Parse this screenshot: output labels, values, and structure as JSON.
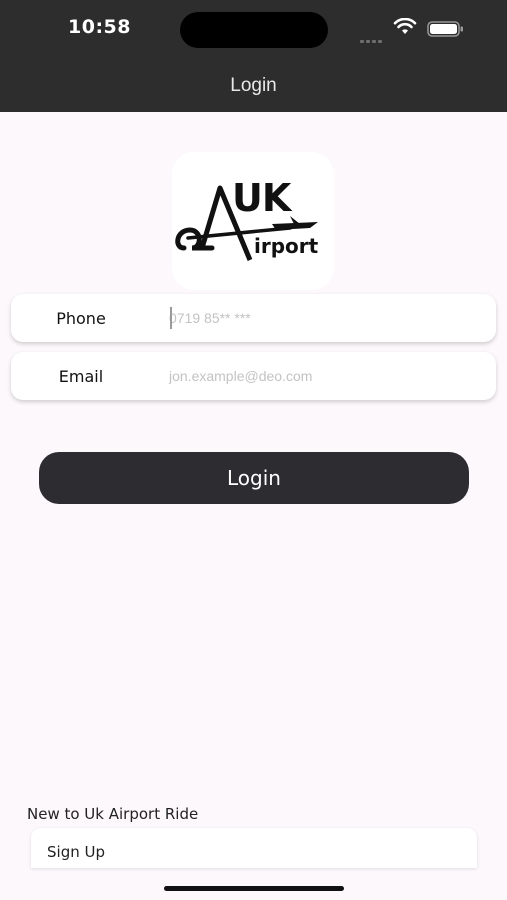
{
  "status_bar": {
    "time": "10:58",
    "icons": [
      "cellular-signal-icon",
      "wifi-icon",
      "battery-icon"
    ]
  },
  "nav": {
    "title": "Login"
  },
  "logo": {
    "line1": "UK",
    "line2": "irport"
  },
  "form": {
    "phone": {
      "label": "Phone",
      "placeholder": "0719 85** ***"
    },
    "email": {
      "label": "Email",
      "placeholder": "jon.example@deo.com"
    },
    "login_label": "Login"
  },
  "footer": {
    "prompt": "New to Uk Airport Ride",
    "signup_label": "Sign Up"
  },
  "colors": {
    "bar_background": "#2d2d2d",
    "page_background": "#fcf8fc",
    "button_background": "#2d2c30"
  }
}
